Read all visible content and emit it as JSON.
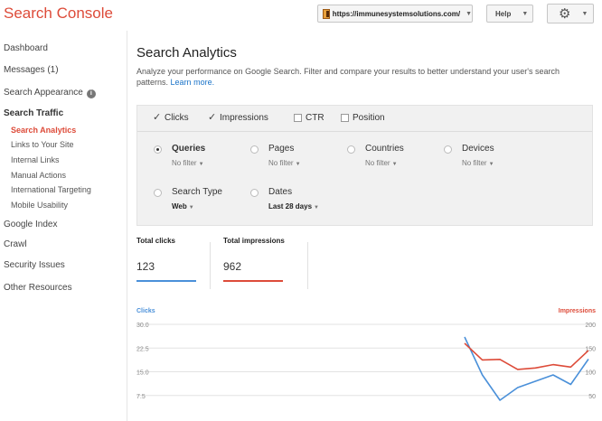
{
  "app": {
    "title": "Search Console"
  },
  "header": {
    "site_url": "https://immunesystemsolutions.com/",
    "help_label": "Help"
  },
  "sidebar": {
    "dashboard": "Dashboard",
    "messages": "Messages (1)",
    "search_appearance": "Search Appearance",
    "search_traffic": "Search Traffic",
    "search_traffic_items": [
      "Search Analytics",
      "Links to Your Site",
      "Internal Links",
      "Manual Actions",
      "International Targeting",
      "Mobile Usability"
    ],
    "google_index": "Google Index",
    "crawl": "Crawl",
    "security_issues": "Security Issues",
    "other_resources": "Other Resources"
  },
  "main": {
    "title": "Search Analytics",
    "description": "Analyze your performance on Google Search. Filter and compare your results to better understand your user's search patterns.",
    "learn_more": "Learn more.",
    "metrics": [
      {
        "label": "Clicks",
        "checked": true
      },
      {
        "label": "Impressions",
        "checked": true
      },
      {
        "label": "CTR",
        "checked": false
      },
      {
        "label": "Position",
        "checked": false
      }
    ],
    "groups": [
      {
        "label": "Queries",
        "sub": "No filter",
        "selected": true
      },
      {
        "label": "Pages",
        "sub": "No filter",
        "selected": false
      },
      {
        "label": "Countries",
        "sub": "No filter",
        "selected": false
      },
      {
        "label": "Devices",
        "sub": "No filter",
        "selected": false
      },
      {
        "label": "Search Type",
        "sub": "Web",
        "selected": false
      },
      {
        "label": "Dates",
        "sub": "Last 28 days",
        "selected": false
      }
    ],
    "totals": [
      {
        "label": "Total clicks",
        "value": "123",
        "color": "#4a90d9"
      },
      {
        "label": "Total impressions",
        "value": "962",
        "color": "#dd4b39"
      }
    ]
  },
  "colors": {
    "brand": "#dd4b39",
    "clicks": "#4a90d9",
    "impressions": "#dd4b39",
    "link": "#1a73c8"
  },
  "chart_data": {
    "type": "line",
    "left_axis_label": "Clicks",
    "right_axis_label": "Impressions",
    "left_ticks": [
      "30.0",
      "22.5",
      "15.0",
      "7.5"
    ],
    "right_ticks": [
      "200",
      "150",
      "100",
      "50"
    ],
    "left_range": [
      0,
      30
    ],
    "right_range": [
      0,
      200
    ],
    "series": [
      {
        "name": "Clicks",
        "axis": "left",
        "color": "#4a90d9",
        "values": [
          26,
          14,
          6,
          10,
          12,
          14,
          11,
          19
        ],
        "x": [
          0,
          1,
          2,
          3,
          4,
          5,
          6,
          7
        ]
      },
      {
        "name": "Impressions",
        "axis": "right",
        "color": "#dd4b39",
        "values": [
          160,
          125,
          126,
          105,
          108,
          115,
          110,
          145
        ],
        "x": [
          0,
          1,
          2,
          3,
          4,
          5,
          6,
          7
        ]
      }
    ]
  }
}
